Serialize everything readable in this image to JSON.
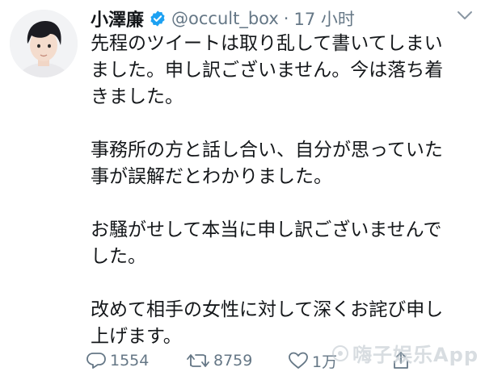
{
  "tweet": {
    "display_name": "小澤廉",
    "handle": "@occult_box",
    "separator": "·",
    "time": "17 小时",
    "paragraphs": [
      [
        "先程のツイートは取り乱して書いてしまい",
        "ました。申し訳ございません。今は落ち着",
        "きました。"
      ],
      [
        "事務所の方と話し合い、自分が思っていた",
        "事が誤解だとわかりました。"
      ],
      [
        "お騒がせして本当に申し訳ございませんで",
        "した。"
      ],
      [
        "改めて相手の女性に対して深くお詫び申し",
        "上げます。"
      ]
    ],
    "reply_count": "1554",
    "retweet_count": "8759",
    "like_count": "1万"
  },
  "watermark": {
    "text": "嗨子娱乐App"
  },
  "icons": {
    "verified": "verified-badge-icon",
    "more": "chevron-down-icon",
    "reply": "reply-icon",
    "retweet": "retweet-icon",
    "like": "heart-icon",
    "share": "share-icon"
  },
  "colors": {
    "verified": "#1da1f2",
    "text": "#14171a",
    "muted": "#657786"
  }
}
